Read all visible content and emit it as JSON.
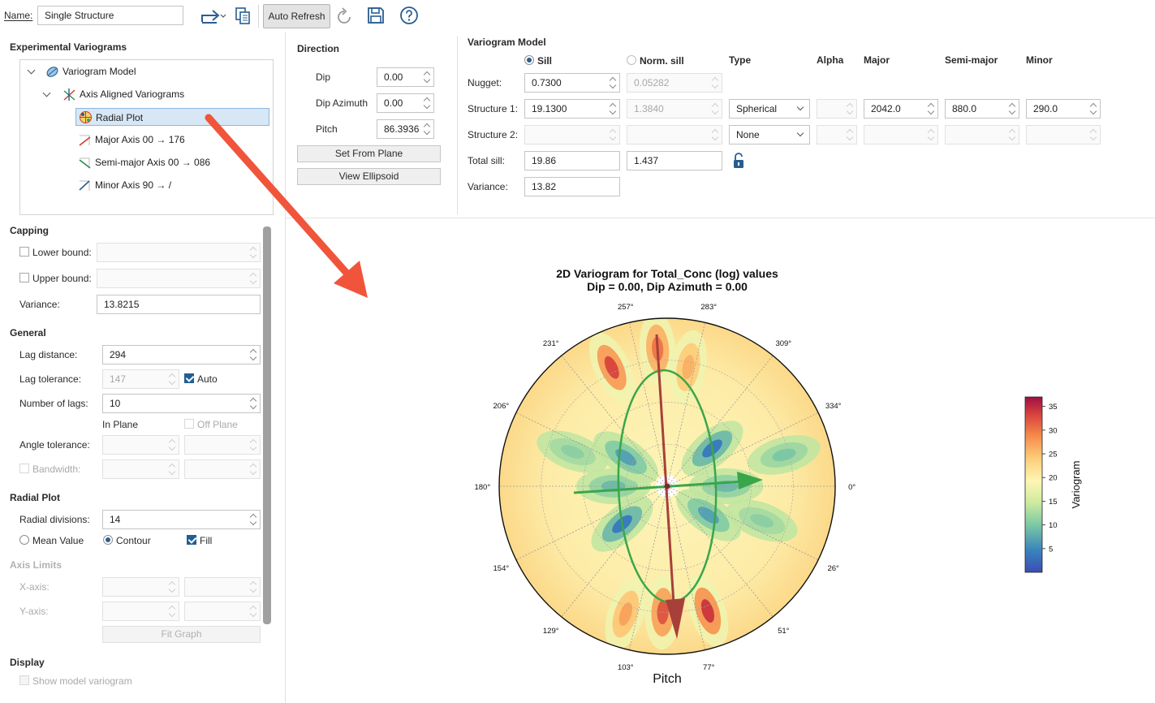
{
  "toolbar": {
    "name_label": "Name:",
    "name_value": "Single Structure",
    "auto_refresh_label": "Auto Refresh"
  },
  "tree": {
    "title": "Experimental Variograms",
    "items": [
      {
        "label": "Variogram Model",
        "icon": "variogram-model-icon"
      },
      {
        "label": "Axis Aligned Variograms",
        "icon": "axis-aligned-icon"
      },
      {
        "label": "Radial Plot",
        "icon": "radial-plot-icon",
        "selected": true
      },
      {
        "label": "Major Axis 00 → 176",
        "icon": "major-axis-icon"
      },
      {
        "label": "Semi-major Axis 00 → 086",
        "icon": "semi-major-axis-icon"
      },
      {
        "label": "Minor Axis 90 → /",
        "icon": "minor-axis-icon"
      }
    ]
  },
  "capping": {
    "title": "Capping",
    "lower_bound_label": "Lower bound:",
    "upper_bound_label": "Upper bound:",
    "variance_label": "Variance:",
    "variance_value": "13.8215"
  },
  "general": {
    "title": "General",
    "lag_distance_label": "Lag distance:",
    "lag_distance_value": "294",
    "lag_tolerance_label": "Lag tolerance:",
    "lag_tolerance_value": "147",
    "auto_label": "Auto",
    "number_of_lags_label": "Number of lags:",
    "number_of_lags_value": "10",
    "in_plane_label": "In Plane",
    "off_plane_label": "Off Plane",
    "angle_tolerance_label": "Angle tolerance:",
    "bandwidth_label": "Bandwidth:"
  },
  "radial_plot": {
    "title": "Radial Plot",
    "radial_divisions_label": "Radial divisions:",
    "radial_divisions_value": "14",
    "mean_value_label": "Mean Value",
    "contour_label": "Contour",
    "fill_label": "Fill"
  },
  "axis_limits": {
    "title": "Axis Limits",
    "x_axis_label": "X-axis:",
    "y_axis_label": "Y-axis:",
    "fit_graph_label": "Fit Graph"
  },
  "display": {
    "title": "Display",
    "show_model_label": "Show model variogram"
  },
  "direction": {
    "title": "Direction",
    "dip_label": "Dip",
    "dip_value": "0.00",
    "dip_azimuth_label": "Dip Azimuth",
    "dip_azimuth_value": "0.00",
    "pitch_label": "Pitch",
    "pitch_value": "86.3936",
    "set_from_plane_label": "Set From Plane",
    "view_ellipsoid_label": "View Ellipsoid"
  },
  "variogram_model": {
    "title": "Variogram Model",
    "sill_label": "Sill",
    "norm_sill_label": "Norm. sill",
    "col_type": "Type",
    "col_alpha": "Alpha",
    "col_major": "Major",
    "col_semi_major": "Semi-major",
    "col_minor": "Minor",
    "nugget_label": "Nugget:",
    "nugget_sill": "0.7300",
    "nugget_norm": "0.05282",
    "structure1_label": "Structure 1:",
    "structure1_sill": "19.1300",
    "structure1_norm": "1.3840",
    "structure1_type": "Spherical",
    "structure1_major": "2042.0",
    "structure1_semi_major": "880.0",
    "structure1_minor": "290.0",
    "structure2_label": "Structure 2:",
    "structure2_type": "None",
    "total_sill_label": "Total sill:",
    "total_sill_value": "19.86",
    "total_norm_value": "1.437",
    "variance_label": "Variance:",
    "variance_value": "13.82"
  },
  "chart": {
    "title_line1": "2D Variogram for Total_Conc (log) values",
    "title_line2": "Dip = 0.00, Dip Azimuth = 0.00",
    "xlabel": "Pitch",
    "colorbar_label": "Variogram",
    "colors": {
      "major_arrow": "#a8403a",
      "minor_arrow": "#3aa64a",
      "ellipse": "#3aa64a"
    }
  },
  "chart_data": {
    "type": "heatmap",
    "title": "2D Variogram for Total_Conc (log) values\nDip = 0.00, Dip Azimuth = 0.00",
    "xlabel": "Pitch",
    "colorbar_label": "Variogram",
    "angle_ticks": [
      {
        "label": "0°",
        "angle": 0
      },
      {
        "label": "26°",
        "angle": 26
      },
      {
        "label": "51°",
        "angle": 51
      },
      {
        "label": "77°",
        "angle": 77
      },
      {
        "label": "103°",
        "angle": 103
      },
      {
        "label": "129°",
        "angle": 129
      },
      {
        "label": "154°",
        "angle": 154
      },
      {
        "label": "180°",
        "angle": 180
      },
      {
        "label": "206°",
        "angle": 206
      },
      {
        "label": "231°",
        "angle": 231
      },
      {
        "label": "257°",
        "angle": 257
      },
      {
        "label": "283°",
        "angle": 283
      },
      {
        "label": "309°",
        "angle": 309
      },
      {
        "label": "334°",
        "angle": 334
      }
    ],
    "colorbar_ticks": [
      5,
      10,
      15,
      20,
      25,
      30,
      35
    ],
    "colorbar_range": [
      0,
      37
    ],
    "blobs": [
      {
        "angle": 266,
        "r": 0.82,
        "value": 30
      },
      {
        "angle": 245,
        "r": 0.78,
        "value": 33
      },
      {
        "angle": 280,
        "r": 0.72,
        "value": 26
      },
      {
        "angle": 92,
        "r": 0.75,
        "value": 32
      },
      {
        "angle": 72,
        "r": 0.78,
        "value": 34
      },
      {
        "angle": 108,
        "r": 0.8,
        "value": 27
      },
      {
        "angle": 0,
        "r": 0.35,
        "value": 9
      },
      {
        "angle": 180,
        "r": 0.32,
        "value": 9
      },
      {
        "angle": 35,
        "r": 0.3,
        "value": 7
      },
      {
        "angle": 215,
        "r": 0.3,
        "value": 7
      },
      {
        "angle": 320,
        "r": 0.35,
        "value": 4
      },
      {
        "angle": 140,
        "r": 0.35,
        "value": 4
      },
      {
        "angle": 20,
        "r": 0.6,
        "value": 11
      },
      {
        "angle": 200,
        "r": 0.6,
        "value": 11
      },
      {
        "angle": 345,
        "r": 0.72,
        "value": 10
      }
    ]
  }
}
